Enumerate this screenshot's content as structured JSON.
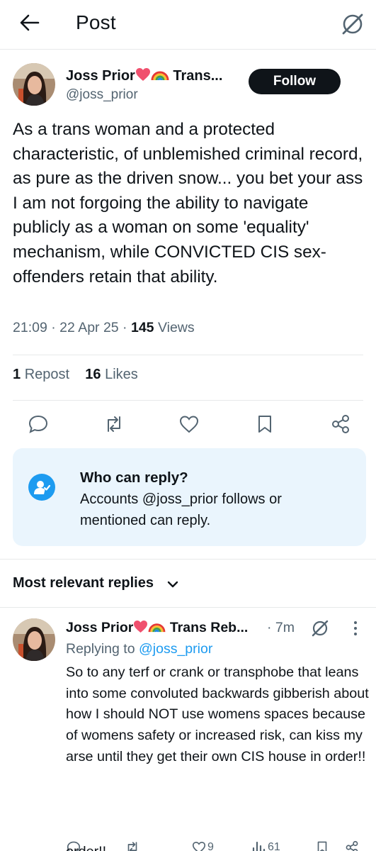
{
  "header": {
    "title": "Post"
  },
  "post": {
    "author_name": "Joss Prior",
    "author_name_suffix": "Trans...",
    "handle": "@joss_prior",
    "follow_label": "Follow",
    "text": "As a trans woman and a protected characteristic, of unblemished criminal record, as pure as the driven snow... you bet your ass I am not forgoing the ability to navigate publicly as a woman on some 'equality' mechanism, while CONVICTED CIS sex-offenders retain that ability.",
    "time": "21:09",
    "date": "22 Apr 25",
    "views_count": "145",
    "views_label": "Views",
    "reposts_count": "1",
    "reposts_label": "Repost",
    "likes_count": "16",
    "likes_label": "Likes"
  },
  "who_can_reply": {
    "title": "Who can reply?",
    "description": "Accounts @joss_prior follows or mentioned can reply."
  },
  "replies_section": {
    "label": "Most relevant replies"
  },
  "reply": {
    "author_name": "Joss Prior",
    "author_name_suffix": "Trans Reb...",
    "time": "· 7m",
    "replying_prefix": "Replying to",
    "replying_to": "@joss_prior",
    "text": "So to any terf or crank or transphobe that leans into some convoluted backwards gibberish about how I should NOT use womens spaces because of womens safety or increased risk, can kiss my arse until they get their own CIS house in order!!",
    "likes": "9",
    "views": "61",
    "cut_text": "order!!"
  },
  "colors": {
    "accent": "#1d9bf0",
    "heart": "#f0506e",
    "text": "#0f1419",
    "muted": "#536471"
  }
}
